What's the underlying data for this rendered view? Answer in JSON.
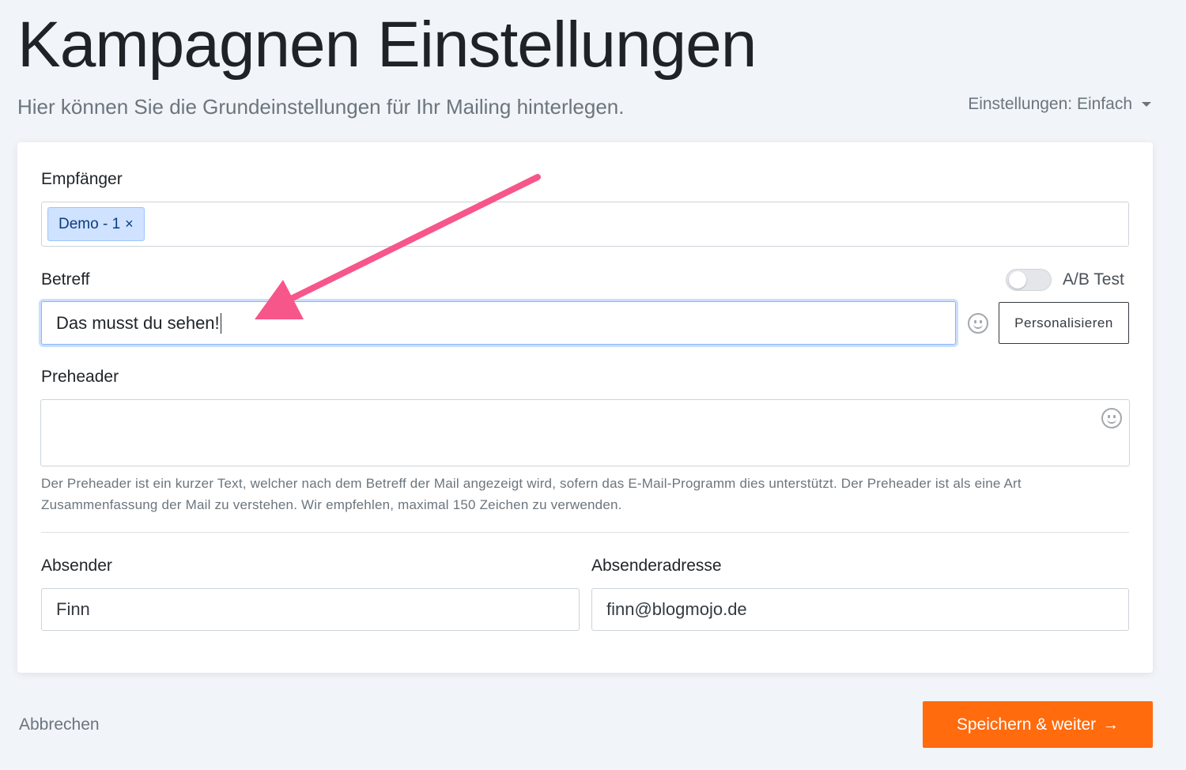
{
  "header": {
    "title": "Kampagnen Einstellungen",
    "subtitle": "Hier können Sie die Grundeinstellungen für Ihr Mailing hinterlegen.",
    "settings_mode": "Einstellungen: Einfach"
  },
  "form": {
    "recipients": {
      "label": "Empfänger",
      "tags": [
        {
          "label": "Demo - 1",
          "remove": "×"
        }
      ]
    },
    "subject": {
      "label": "Betreff",
      "value": "Das musst du sehen!",
      "ab_test_label": "A/B Test",
      "ab_test_enabled": false,
      "personalize_label": "Personalisieren"
    },
    "preheader": {
      "label": "Preheader",
      "value": "",
      "help": "Der Preheader ist ein kurzer Text, welcher nach dem Betreff der Mail angezeigt wird, sofern das E-Mail-Programm dies unterstützt. Der Preheader ist als eine Art Zusammenfassung der Mail zu verstehen. Wir empfehlen, maximal 150 Zeichen zu verwenden."
    },
    "sender": {
      "label": "Absender",
      "value": "Finn"
    },
    "sender_address": {
      "label": "Absenderadresse",
      "value": "finn@blogmojo.de"
    }
  },
  "footer": {
    "cancel_label": "Abbrechen",
    "save_label": "Speichern & weiter",
    "save_arrow": "→"
  },
  "colors": {
    "accent": "#ff6b0d",
    "annotation_arrow": "#f7568a",
    "tag_bg": "#cfe2ff",
    "focus_border": "#86b7fe"
  },
  "icons": {
    "settings_caret": "chevron-down-icon",
    "emoji": "smiley-icon",
    "annotation": "annotation-arrow-icon"
  }
}
